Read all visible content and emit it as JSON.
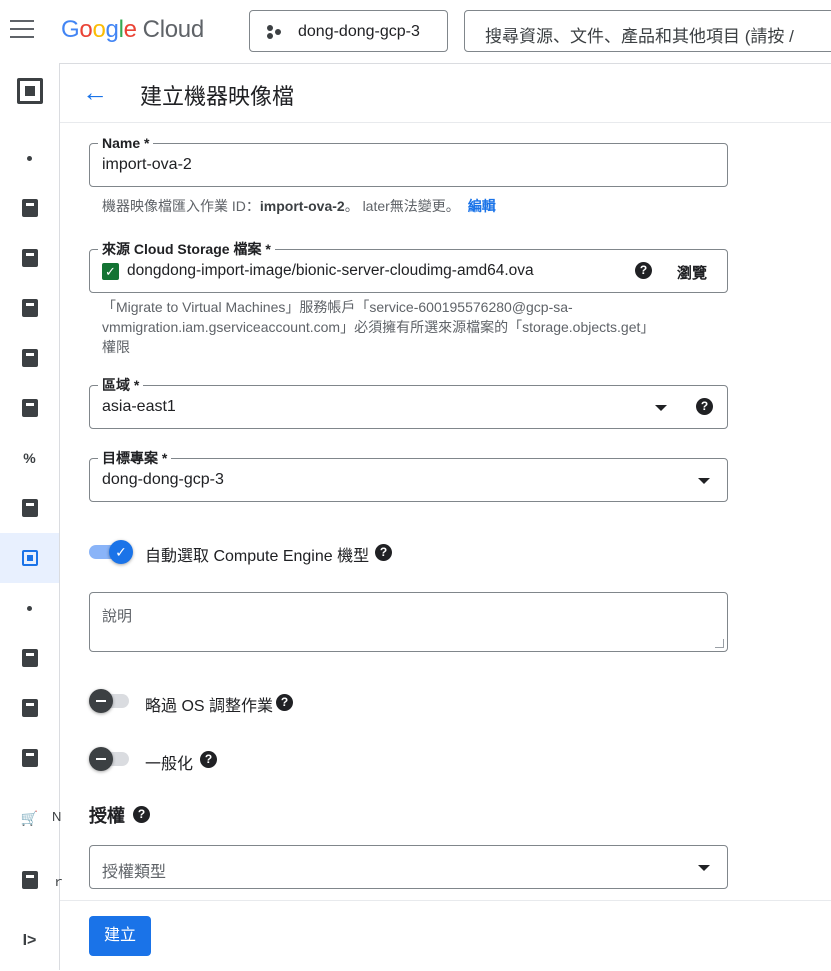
{
  "topbar": {
    "logo_google": [
      "G",
      "o",
      "o",
      "g",
      "l",
      "e"
    ],
    "logo_cloud": "Cloud",
    "project": "dong-dong-gcp-3",
    "search_placeholder": "搜尋資源、文件、產品和其他項目 (請按 /"
  },
  "rail": {
    "cut_labels": [
      "N",
      "ｒ"
    ]
  },
  "header": {
    "title": "建立機器映像檔"
  },
  "form": {
    "name": {
      "label": "Name *",
      "value": "import-ova-2"
    },
    "name_hint": {
      "prefix": "機器映像檔匯入作業 ID：",
      "id": "import-ova-2",
      "suffix": "。 later無法變更。",
      "edit": "編輯"
    },
    "source": {
      "label": "來源 Cloud Storage 檔案 *",
      "value": "dongdong-import-image/bionic-server-cloudimg-amd64.ova",
      "browse": "瀏覽"
    },
    "source_hint": [
      "「Migrate to Virtual Machines」服務帳戶「service-600195576280@gcp-sa-",
      "vmmigration.iam.gserviceaccount.com」必須擁有所選來源檔案的「storage.objects.get」",
      "權限"
    ],
    "region": {
      "label": "區域 *",
      "value": "asia-east1"
    },
    "target_project": {
      "label": "目標專案 *",
      "value": "dong-dong-gcp-3"
    },
    "auto_machine_type": {
      "label": "自動選取 Compute Engine 機型",
      "on": true
    },
    "description": {
      "placeholder": "說明"
    },
    "skip_os": {
      "label": "略過 OS 調整作業",
      "on": false
    },
    "generalize": {
      "label": "一般化",
      "on": false
    },
    "license_section": "授權",
    "license_type": {
      "placeholder": "授權類型"
    }
  },
  "footer": {
    "create_label": "建立"
  },
  "colors": {
    "accent": "#1a73e8",
    "check": "#137333"
  }
}
